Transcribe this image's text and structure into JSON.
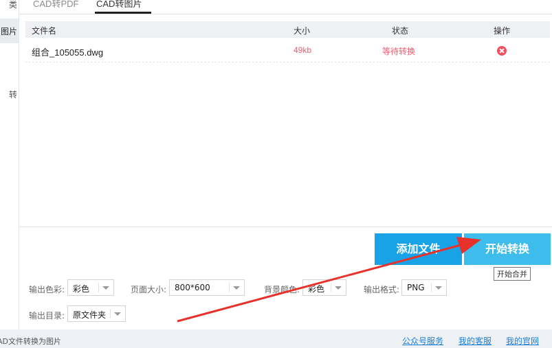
{
  "sidebar": {
    "items": [
      {
        "label": "类",
        "active": false
      },
      {
        "label": "图片",
        "active": true
      },
      {
        "label": "转",
        "active": false
      }
    ]
  },
  "tabs": [
    {
      "label": "CAD转PDF",
      "active": false
    },
    {
      "label": "CAD转图片",
      "active": true
    }
  ],
  "table": {
    "headers": [
      "文件名",
      "大小",
      "状态",
      "操作"
    ],
    "rows": [
      {
        "name": "组合_105055.dwg",
        "size": "49kb",
        "status": "等待转换",
        "action_icon": "delete-icon"
      }
    ]
  },
  "buttons": {
    "add_files": "添加文件",
    "start_convert": "开始转换",
    "tooltip": "开始合并"
  },
  "options": {
    "color_label": "输出色彩:",
    "color_value": "彩色",
    "page_size_label": "页面大小:",
    "page_size_value": "800*600",
    "bg_color_label": "背景颜色:",
    "bg_color_value": "彩色",
    "format_label": "输出格式:",
    "format_value": "PNG",
    "dir_label": "输出目录:",
    "dir_value": "原文件夹"
  },
  "footer": {
    "title": "AD文件转换为图片",
    "links": [
      "公众号服务",
      "我的客服",
      "我的官网"
    ]
  },
  "colors": {
    "accent_blue": "#1aa2e6",
    "light_blue": "#3ebcec",
    "status_red": "#f05a6e",
    "annotation_red": "#e8312a"
  }
}
